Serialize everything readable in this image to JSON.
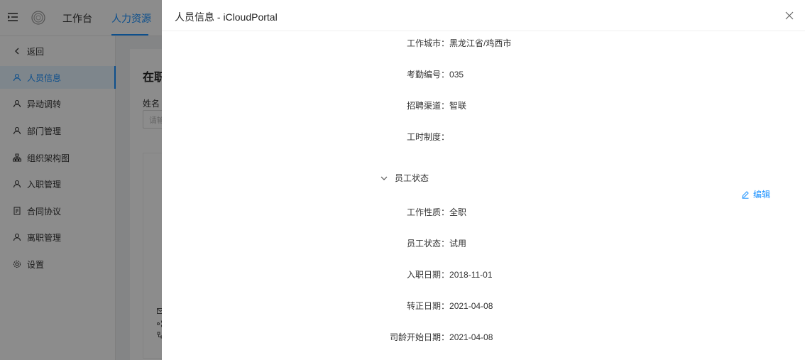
{
  "topbar": {
    "nav": [
      {
        "label": "工作台"
      },
      {
        "label": "人力资源"
      }
    ]
  },
  "sidebar": {
    "items": [
      {
        "label": "返回",
        "icon": "chevron-left-icon"
      },
      {
        "label": "人员信息",
        "icon": "user-icon"
      },
      {
        "label": "异动调转",
        "icon": "user-icon"
      },
      {
        "label": "部门管理",
        "icon": "user-icon"
      },
      {
        "label": "组织架构图",
        "icon": "org-chart-icon"
      },
      {
        "label": "入职管理",
        "icon": "user-icon"
      },
      {
        "label": "合同协议",
        "icon": "document-icon"
      },
      {
        "label": "离职管理",
        "icon": "user-icon"
      },
      {
        "label": "设置",
        "icon": "gear-icon"
      }
    ]
  },
  "main": {
    "title": "在职",
    "name_label": "姓名",
    "name_placeholder": "请输"
  },
  "drawer": {
    "title": "人员信息 - iCloudPortal",
    "fields_top": [
      {
        "label": "工作城市：",
        "value": "黑龙江省/鸡西市"
      },
      {
        "label": "考勤编号：",
        "value": "035"
      },
      {
        "label": "招聘渠道：",
        "value": "智联"
      },
      {
        "label": "工时制度：",
        "value": ""
      }
    ],
    "section": {
      "title": "员工状态",
      "edit_label": "编辑"
    },
    "fields_status": [
      {
        "label": "工作性质：",
        "value": "全职"
      },
      {
        "label": "员工状态：",
        "value": "试用"
      },
      {
        "label": "入职日期：",
        "value": "2018-11-01"
      },
      {
        "label": "转正日期：",
        "value": "2021-04-08"
      },
      {
        "label": "司龄开始日期：",
        "value": "2021-04-08"
      }
    ]
  },
  "colors": {
    "accent": "#1890ff",
    "overlay": "rgba(0,0,0,0.45)"
  }
}
